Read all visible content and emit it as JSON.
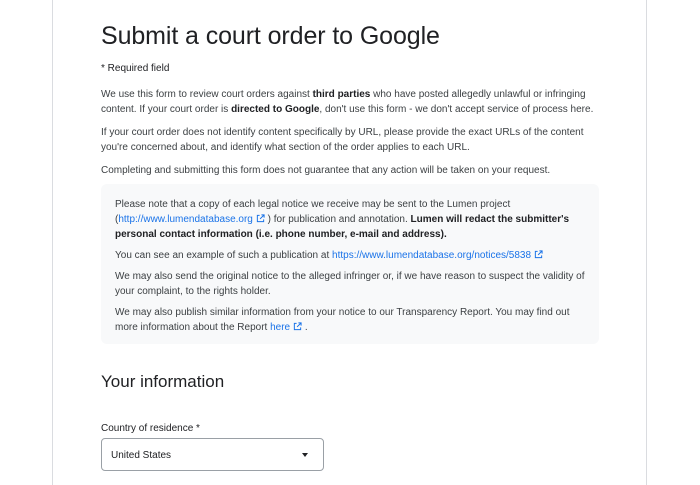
{
  "page": {
    "title": "Submit a court order to Google",
    "required_note": "* Required field"
  },
  "intro": {
    "p1_a": "We use this form to review court orders against ",
    "p1_b": "third parties",
    "p1_c": " who have posted allegedly unlawful or infringing content. If your court order is ",
    "p1_d": "directed to Google",
    "p1_e": ", don't use this form - we don't accept service of process here.",
    "p2": "If your court order does not identify content specifically by URL, please provide the exact URLs of the content you're concerned about, and identify what section of the order applies to each URL.",
    "p3": "Completing and submitting this form does not guarantee that any action will be taken on your request."
  },
  "notice": {
    "n1_a": "Please note that a copy of each legal notice we receive may be sent to the Lumen project (",
    "n1_link": "http://www.lumendatabase.org",
    "n1_b": " ) for publication and annotation. ",
    "n1_bold": "Lumen will redact the submitter's personal contact information (i.e. phone number, e-mail and address).",
    "n2_a": "You can see an example of such a publication at ",
    "n2_link": "https://www.lumendatabase.org/notices/5838",
    "n3": "We may also send the original notice to the alleged infringer or, if we have reason to suspect the validity of your complaint, to the rights holder.",
    "n4_a": "We may also publish similar information from your notice to our Transparency Report. You may find out more information about the Report ",
    "n4_link": "here",
    "n4_b": " ."
  },
  "your_info": {
    "heading": "Your information",
    "country_label": "Country of residence *",
    "country_value": "United States"
  },
  "icons": {
    "external": "external-link-icon",
    "dropdown": "chevron-down-icon"
  },
  "colors": {
    "link": "#1a73e8",
    "notice_bg": "#f8f9fa",
    "text": "#202124"
  }
}
